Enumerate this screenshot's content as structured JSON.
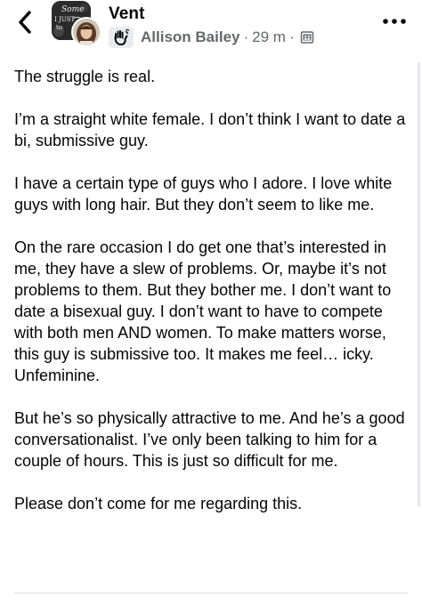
{
  "header": {
    "group_name": "Vent",
    "author": "Allison Bailey",
    "separator": "·",
    "time": "29 m",
    "back_icon": "chevron-left-icon",
    "more_icon": "more-horizontal-icon",
    "privacy_icon": "members-only-icon"
  },
  "group_avatar": {
    "lines": [
      "Some",
      "I JUST",
      "to"
    ]
  },
  "post": {
    "paragraphs": [
      "The struggle is real.",
      "I’m a straight white female. I don’t think I want to date a bi, submissive guy.",
      "I have a certain type of guys who I adore. I love white guys with long hair. But they don’t seem to like me.",
      "On the rare occasion I do get one that’s interested in me, they have a slew of problems. Or, maybe it’s not problems to them. But they bother me. I don’t want to date a bisexual guy. I don’t want to have to compete with both men AND women. To make matters worse, this guy is submissive too. It makes me feel… icky. Unfeminine.",
      "But he’s so physically attractive to me. And he’s a good conversationalist. I’ve only been talking to him for a couple of hours. This is just so difficult for me.",
      "Please don’t come for me regarding this."
    ]
  },
  "colors": {
    "text": "#050505",
    "meta": "#65676b",
    "divider": "#dadde1"
  }
}
